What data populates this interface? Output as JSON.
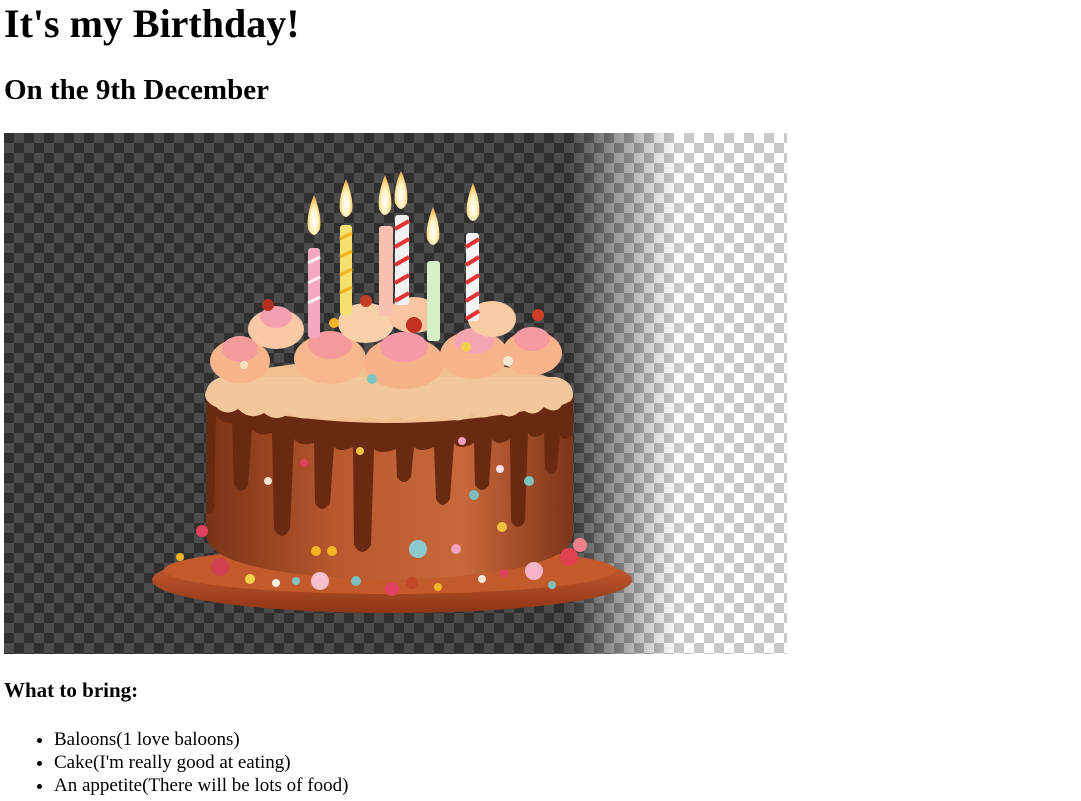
{
  "heading": "It's my Birthday!",
  "subheading": "On the 9th December",
  "image": {
    "subject": "birthday-cake-with-candles",
    "colors": {
      "frosting": "#f5c9a2",
      "chocolate": "#7a3216",
      "cake_body": "#b8582e",
      "plate": "#b34d24"
    }
  },
  "bring_heading": "What to bring:",
  "bring_items": [
    "Baloons(1 love baloons)",
    "Cake(I'm really good at eating)",
    "An appetite(There will be lots of food)"
  ]
}
